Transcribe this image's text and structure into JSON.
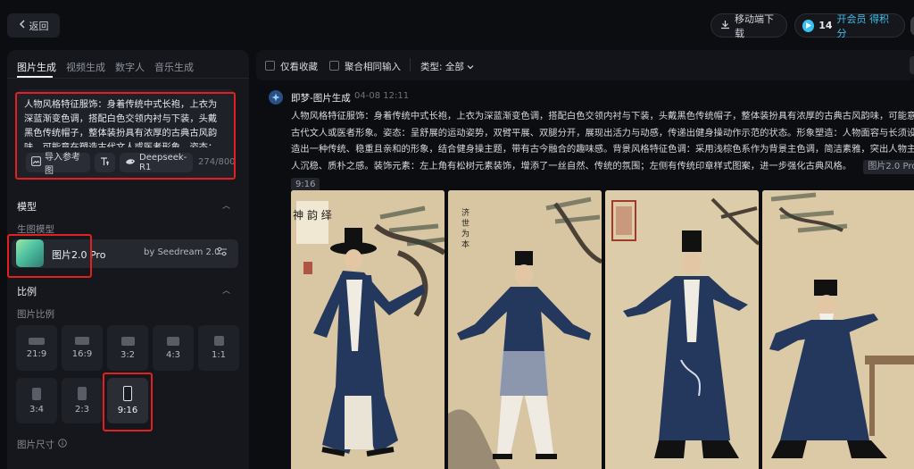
{
  "header": {
    "back_label": "返回",
    "download_label": "移动端下载",
    "credits": "14",
    "credits_link": "开会员 得积分"
  },
  "tabs": [
    {
      "label": "图片生成",
      "active": true
    },
    {
      "label": "视频生成",
      "active": false
    },
    {
      "label": "数字人",
      "active": false
    },
    {
      "label": "音乐生成",
      "active": false
    }
  ],
  "prompt": {
    "text": "人物风格特征服饰：身着传统中式长袍，上衣为深蓝渐变色调，搭配白色交领内衬与下装，头戴黑色传统帽子，整体装扮具有浓厚的古典古风韵味，可能意在塑造古代文人或医者形象。姿态：呈舒展的",
    "import_ref_label": "导入参考图",
    "deepseek_label": "Deepseek-R1",
    "char_count": "274/800"
  },
  "model_section": {
    "title": "模型",
    "subtitle": "生图模型",
    "model_name": "图片2.0 Pro",
    "model_by": "by Seedream 2.0"
  },
  "ratio_section": {
    "title": "比例",
    "subtitle": "图片比例",
    "ratios": [
      "21:9",
      "16:9",
      "3:2",
      "4:3",
      "1:1",
      "3:4",
      "2:3",
      "9:16"
    ],
    "selected": "9:16",
    "size_title": "图片尺寸"
  },
  "filters": {
    "collect_label": "仅看收藏",
    "aggregate_label": "聚合相同输入",
    "type_label": "类型: 全部"
  },
  "message": {
    "sender": "即梦-图片生成",
    "time": "04-08  12:11",
    "lines": [
      "人物风格特征服饰：身着传统中式长袍，上衣为深蓝渐变色调，搭配白色交领内衬与下装，头戴黑色传统帽子，整体装扮具有浓厚的古典古风韵味，可能意在塑造",
      "古代文人或医者形象。姿态：呈舒展的运动姿势，双臂平展、双腿分开，展现出活力与动感，传递出健身操动作示范的状态。形象塑造：人物面容与长须设计，营",
      "造出一种传统、稳重且亲和的形象，结合健身操主题，带有古今融合的趣味感。背景风格特征色调：采用浅棕色系作为背景主色调，简洁素雅，突出人物主体，给",
      "人沉稳、质朴之感。装饰元素：左上角有松树元素装饰，增添了一丝自然、传统的氛围；左侧有传统印章样式图案，进一步强化古典风格。"
    ],
    "model_tag": "图片2.0 Pro",
    "ratio_tag": "9:16"
  },
  "images": [
    {
      "seal_text": "神 韵 绎"
    },
    {
      "seal_text": "济 世 为 本"
    },
    {
      "seal_text": ""
    },
    {
      "seal_text": ""
    }
  ],
  "colors": {
    "accent": "#3fbde8",
    "highlight": "#e32020",
    "robe": "#24385e",
    "parchment": "#d6c3a0"
  }
}
